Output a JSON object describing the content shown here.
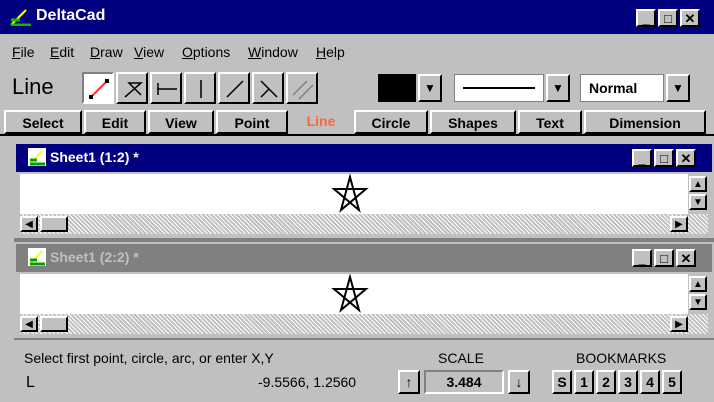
{
  "app": {
    "title": "DeltaCad"
  },
  "menu": [
    {
      "label": "File"
    },
    {
      "label": "Edit"
    },
    {
      "label": "Draw"
    },
    {
      "label": "View"
    },
    {
      "label": "Options"
    },
    {
      "label": "Window"
    },
    {
      "label": "Help"
    }
  ],
  "toolbar": {
    "mode_label": "Line",
    "tools": [
      "line-two-points-icon",
      "line-connected-icon",
      "horizontal-line-icon",
      "vertical-line-icon",
      "angled-line-icon",
      "perpendicular-line-icon",
      "parallel-line-icon"
    ],
    "color_value": "#000000",
    "style_value": "Normal"
  },
  "tabs": [
    {
      "label": "Select"
    },
    {
      "label": "Edit"
    },
    {
      "label": "View"
    },
    {
      "label": "Point"
    },
    {
      "label": "Line",
      "active": true
    },
    {
      "label": "Circle"
    },
    {
      "label": "Shapes"
    },
    {
      "label": "Text"
    },
    {
      "label": "Dimension"
    }
  ],
  "windows": [
    {
      "title": "Sheet1 (1:2) *",
      "active": true
    },
    {
      "title": "Sheet1 (2:2) *",
      "active": false
    }
  ],
  "status": {
    "prompt": "Select first point, circle, arc, or enter X,Y",
    "coords": "-9.5566, 1.2560",
    "scale_label": "SCALE",
    "scale_value": "3.484",
    "bookmarks_label": "BOOKMARKS",
    "bookmarks": [
      "S",
      "1",
      "2",
      "3",
      "4",
      "5"
    ],
    "mode_glyph": "L"
  },
  "colors": {
    "titlebar_active": "#000080",
    "titlebar_inactive": "#808080",
    "active_tab": "#ff6633"
  }
}
